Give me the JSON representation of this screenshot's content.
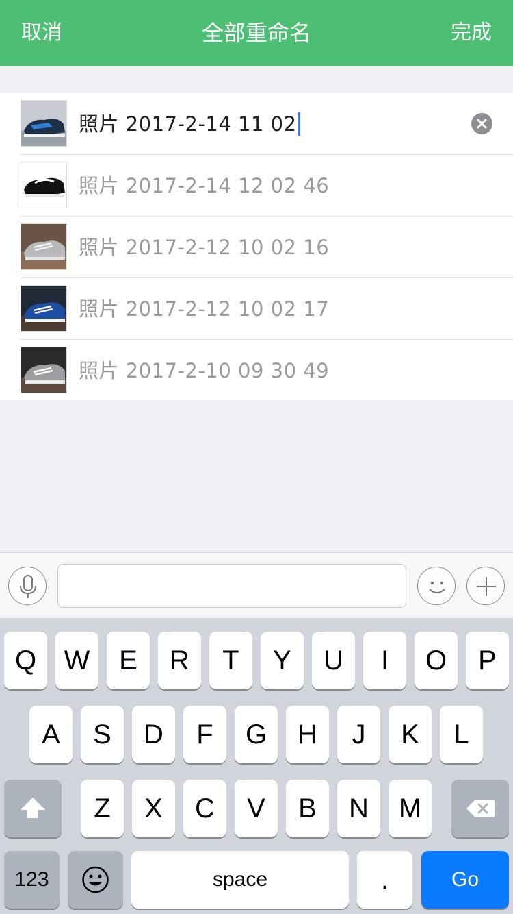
{
  "header": {
    "cancel_label": "取消",
    "title": "全部重命名",
    "done_label": "完成"
  },
  "photos": [
    {
      "prefix": "照片",
      "name": "2017-2-14 11 02",
      "editing": true
    },
    {
      "prefix": "照片",
      "name": "2017-2-14 12 02 46"
    },
    {
      "prefix": "照片",
      "name": "2017-2-12 10 02 16"
    },
    {
      "prefix": "照片",
      "name": "2017-2-12 10 02 17"
    },
    {
      "prefix": "照片",
      "name": "2017-2-10 09 30 49"
    }
  ],
  "keyboard": {
    "row1": [
      "Q",
      "W",
      "E",
      "R",
      "T",
      "Y",
      "U",
      "I",
      "O",
      "P"
    ],
    "row2": [
      "A",
      "S",
      "D",
      "F",
      "G",
      "H",
      "J",
      "K",
      "L"
    ],
    "row3": [
      "Z",
      "X",
      "C",
      "V",
      "B",
      "N",
      "M"
    ],
    "numbers_label": "123",
    "space_label": "space",
    "period_label": ".",
    "go_label": "Go"
  },
  "icons": {
    "clear": "clear-circle-icon",
    "mic": "microphone-icon",
    "emoji": "smiley-icon",
    "plus": "plus-icon",
    "shift": "shift-arrow-icon",
    "delete": "backspace-icon",
    "emoji_key": "emoji-key-icon"
  },
  "colors": {
    "header_green": "#4cbf74",
    "go_blue": "#0a7aff",
    "caret_blue": "#2f7cf6"
  }
}
